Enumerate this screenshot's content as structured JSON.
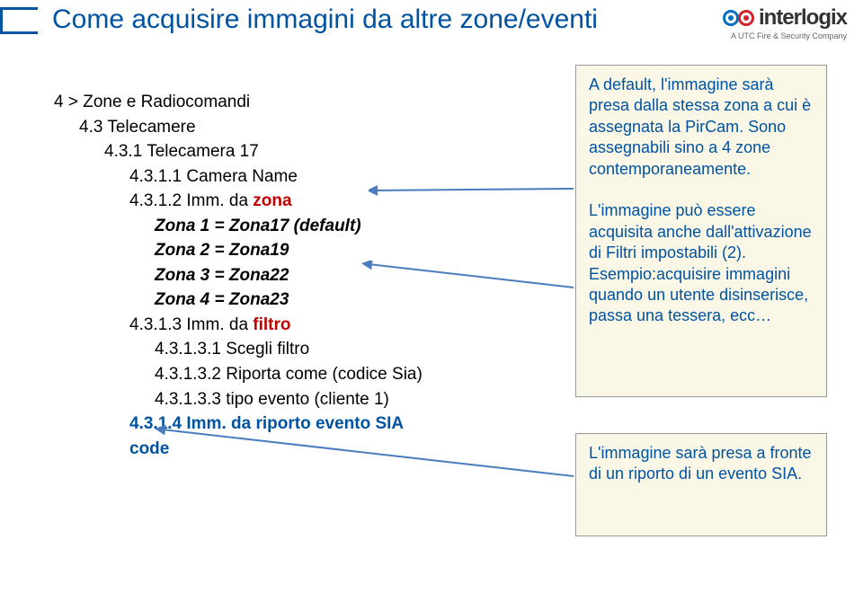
{
  "logo": {
    "brand": "interlogix",
    "tagline": "A UTC Fire & Security Company"
  },
  "title": "Come acquisire immagini da altre zone/eventi",
  "tree": {
    "l1": "4 > Zone e Radiocomandi",
    "l2a": "4.3 Telecamere",
    "l3a": "4.3.1 Telecamera 17",
    "l4a": "4.3.1.1 Camera Name",
    "l4b_prefix": "4.3.1.2 Imm. da ",
    "l4b_suffix": "zona",
    "l5a": "Zona 1 = Zona17 (default)",
    "l5b": "Zona 2 = Zona19",
    "l5c": "Zona 3 = Zona22",
    "l5d": "Zona 4 = Zona23",
    "l4c_prefix": "4.3.1.3 Imm. da ",
    "l4c_suffix": "filtro",
    "l5e": "4.3.1.3.1 Scegli filtro",
    "l5f": "4.3.1.3.2 Riporta come (codice Sia)",
    "l5g": "4.3.1.3.3 tipo evento (cliente 1)",
    "l4d": "4.3.1.4 Imm. da riporto evento SIA code"
  },
  "callout1": "A default, l'immagine sarà presa dalla stessa zona a cui è assegnata la PirCam. Sono assegnabili sino a 4 zone contemporaneamente.\n\nL'immagine può essere acquisita anche dall'attivazione di Filtri impostabili  (2). Esempio:acquisire immagini quando un utente disinserisce, passa una tessera, ecc…",
  "callout2": "L'immagine sarà presa a fronte di un riporto di un evento SIA."
}
